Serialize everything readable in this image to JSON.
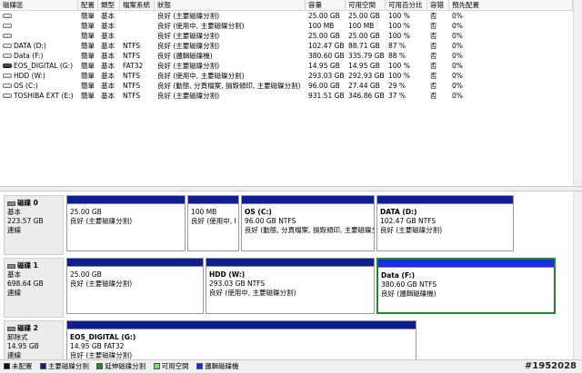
{
  "volume_list": {
    "headers": [
      "磁碟區",
      "配置",
      "類型",
      "檔案系統",
      "狀態",
      "容量",
      "可用空間",
      "可用百分比",
      "容錯",
      "預先配置"
    ],
    "rows": [
      {
        "name": "",
        "layout": "簡單",
        "type": "基本",
        "fs": "",
        "status": "良好 (主要磁碟分割)",
        "capacity": "25.00 GB",
        "free": "25.00 GB",
        "pct": "100 %",
        "fault": "否",
        "overhead": "0%"
      },
      {
        "name": "",
        "layout": "簡單",
        "type": "基本",
        "fs": "",
        "status": "良好 (使用中, 主要磁碟分割)",
        "capacity": "100 MB",
        "free": "100 MB",
        "pct": "100 %",
        "fault": "否",
        "overhead": "0%"
      },
      {
        "name": "",
        "layout": "簡單",
        "type": "基本",
        "fs": "",
        "status": "良好 (主要磁碟分割)",
        "capacity": "25.00 GB",
        "free": "25.00 GB",
        "pct": "100 %",
        "fault": "否",
        "overhead": "0%"
      },
      {
        "name": "DATA (D:)",
        "layout": "簡單",
        "type": "基本",
        "fs": "NTFS",
        "status": "良好 (主要磁碟分割)",
        "capacity": "102.47 GB",
        "free": "88.71 GB",
        "pct": "87 %",
        "fault": "否",
        "overhead": "0%"
      },
      {
        "name": "Data (F:)",
        "layout": "簡單",
        "type": "基本",
        "fs": "NTFS",
        "status": "良好 (邏輯磁碟機)",
        "capacity": "380.60 GB",
        "free": "335.79 GB",
        "pct": "88 %",
        "fault": "否",
        "overhead": "0%"
      },
      {
        "name": "EOS_DIGITAL (G:)",
        "layout": "簡單",
        "type": "基本",
        "fs": "FAT32",
        "status": "良好 (主要磁碟分割)",
        "capacity": "14.95 GB",
        "free": "14.95 GB",
        "pct": "100 %",
        "fault": "否",
        "overhead": "0%"
      },
      {
        "name": "HDD (W:)",
        "layout": "簡單",
        "type": "基本",
        "fs": "NTFS",
        "status": "良好 (使用中, 主要磁碟分割)",
        "capacity": "293.03 GB",
        "free": "292.93 GB",
        "pct": "100 %",
        "fault": "否",
        "overhead": "0%"
      },
      {
        "name": "OS (C:)",
        "layout": "簡單",
        "type": "基本",
        "fs": "NTFS",
        "status": "良好 (動態, 分頁檔案, 損毀傾印, 主要磁碟分割)",
        "capacity": "96.00 GB",
        "free": "27.44 GB",
        "pct": "29 %",
        "fault": "否",
        "overhead": "0%"
      },
      {
        "name": "TOSHIBA EXT (E:)",
        "layout": "簡單",
        "type": "基本",
        "fs": "NTFS",
        "status": "良好 (主要磁碟分割)",
        "capacity": "931.51 GB",
        "free": "346.86 GB",
        "pct": "37 %",
        "fault": "否",
        "overhead": "0%"
      }
    ]
  },
  "disks": [
    {
      "name": "磁碟 0",
      "type": "基本",
      "size": "223.57 GB",
      "state": "連線",
      "partitions": [
        {
          "name": "",
          "size": "25.00 GB",
          "status": "良好 (主要磁碟分割)"
        },
        {
          "name": "",
          "size": "100 MB",
          "status": "良好 (使用中, I"
        },
        {
          "name": "OS (C:)",
          "size": "96.00 GB NTFS",
          "status": "良好 (動態, 分頁檔案, 損毀傾印, 主要磁碟分割)"
        },
        {
          "name": "DATA (D:)",
          "size": "102.47 GB NTFS",
          "status": "良好 (主要磁碟分割)"
        }
      ]
    },
    {
      "name": "磁碟 1",
      "type": "基本",
      "size": "698.64 GB",
      "state": "連線",
      "partitions": [
        {
          "name": "",
          "size": "25.00 GB",
          "status": "良好 (主要磁碟分割)"
        },
        {
          "name": "HDD (W:)",
          "size": "293.03 GB NTFS",
          "status": "良好 (使用中, 主要磁碟分割)"
        },
        {
          "name": "Data (F:)",
          "size": "380.60 GB NTFS",
          "status": "良好 (邏輯磁碟機)"
        }
      ]
    },
    {
      "name": "磁碟 2",
      "type": "卸除式",
      "size": "14.95 GB",
      "state": "連線",
      "partitions": [
        {
          "name": "EOS_DIGITAL (G:)",
          "size": "14.95 GB FAT32",
          "status": "良好 (主要磁碟分割)"
        }
      ]
    }
  ],
  "legend": [
    {
      "label": "未配置",
      "color": "#000000"
    },
    {
      "label": "主要磁碟分割",
      "color": "#0f1f8f"
    },
    {
      "label": "延伸磁碟分割",
      "color": "#1d8a26"
    },
    {
      "label": "可用空間",
      "color": "#6fe06a"
    },
    {
      "label": "邏輯磁碟機",
      "color": "#1c2fe0"
    }
  ],
  "watermark": "#1952028"
}
